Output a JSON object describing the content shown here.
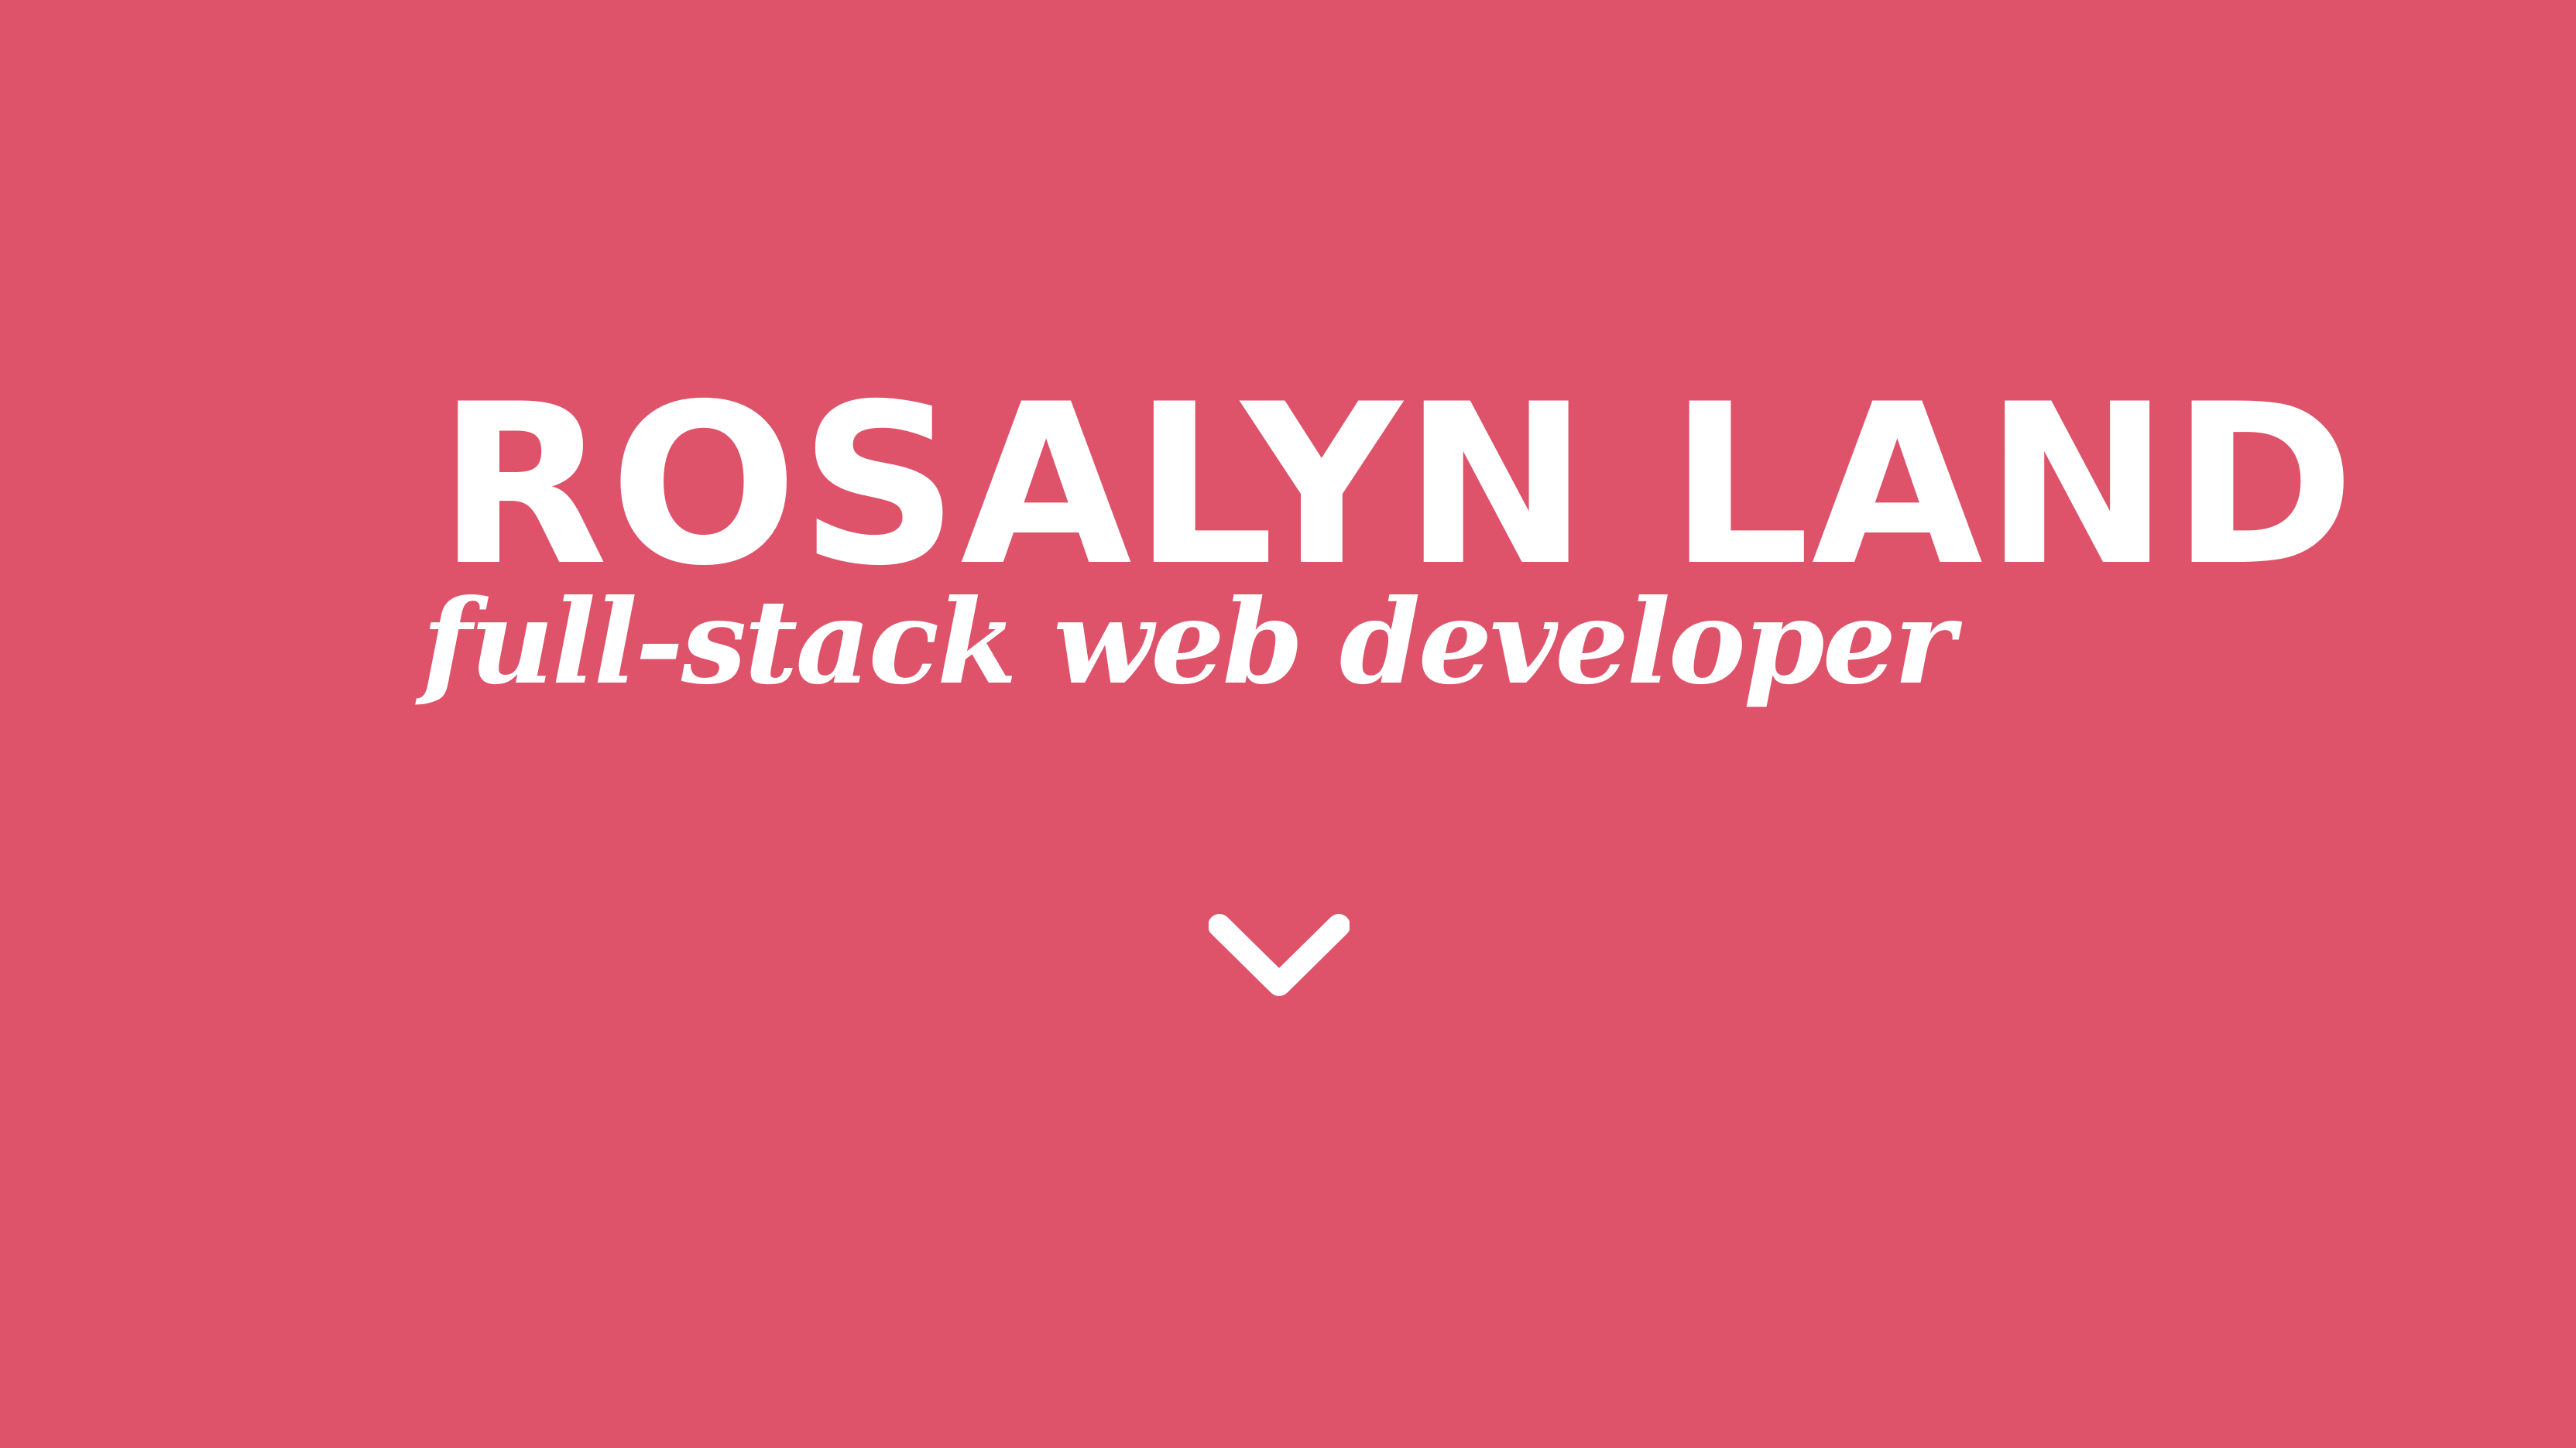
{
  "hero": {
    "name": "ROSALYN LAND",
    "tagline": "full-stack web developer",
    "scroll_icon": "chevron-down-icon",
    "background_color": "#de526a",
    "text_color": "#ffffff"
  }
}
